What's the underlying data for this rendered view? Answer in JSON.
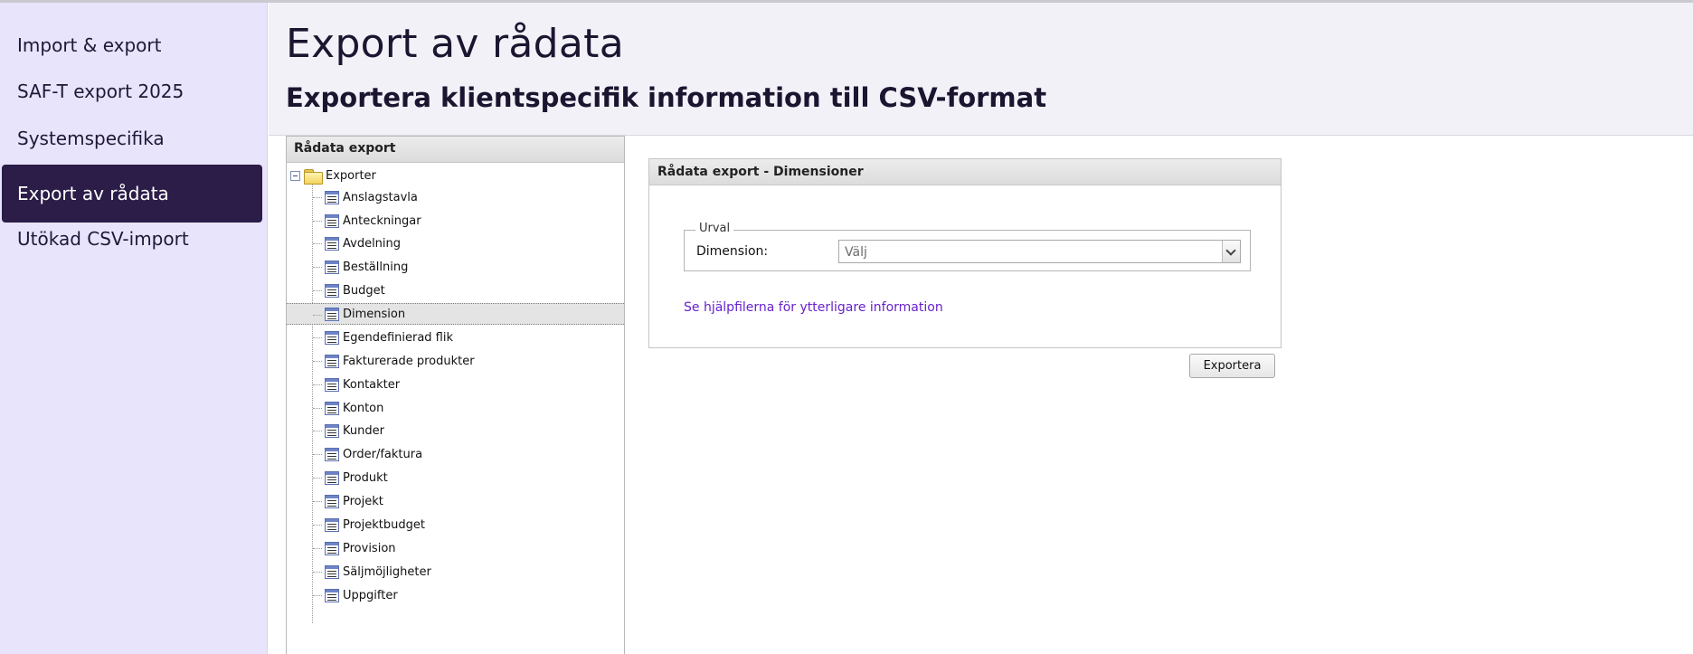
{
  "sidebar": {
    "items": [
      {
        "label": "Import & export"
      },
      {
        "label": "SAF-T export 2025"
      },
      {
        "label": "Systemspecifika"
      },
      {
        "label": "Export av rådata",
        "active": true
      },
      {
        "label": "Utökad CSV-import"
      }
    ]
  },
  "header": {
    "title": "Export av rådata",
    "subtitle": "Exportera klientspecifik information till CSV-format"
  },
  "tree": {
    "panel_title": "Rådata export",
    "root_label": "Exporter",
    "selected": "Dimension",
    "items": [
      {
        "label": "Anslagstavla"
      },
      {
        "label": "Anteckningar"
      },
      {
        "label": "Avdelning"
      },
      {
        "label": "Beställning"
      },
      {
        "label": "Budget"
      },
      {
        "label": "Dimension"
      },
      {
        "label": "Egendefinierad flik"
      },
      {
        "label": "Fakturerade produkter"
      },
      {
        "label": "Kontakter"
      },
      {
        "label": "Konton"
      },
      {
        "label": "Kunder"
      },
      {
        "label": "Order/faktura"
      },
      {
        "label": "Produkt"
      },
      {
        "label": "Projekt"
      },
      {
        "label": "Projektbudget"
      },
      {
        "label": "Provision"
      },
      {
        "label": "Säljmöjligheter"
      },
      {
        "label": "Uppgifter"
      }
    ]
  },
  "detail": {
    "title": "Rådata export - Dimensioner",
    "fieldset_legend": "Urval",
    "dimension_label": "Dimension:",
    "dimension_value": "Välj",
    "help_link": "Se hjälpfilerna för ytterligare information"
  },
  "actions": {
    "export_label": "Exportera"
  },
  "colors": {
    "sidebar_bg": "#e8e4fb",
    "sidebar_active_bg": "#2b1d48",
    "link": "#6622cc"
  }
}
